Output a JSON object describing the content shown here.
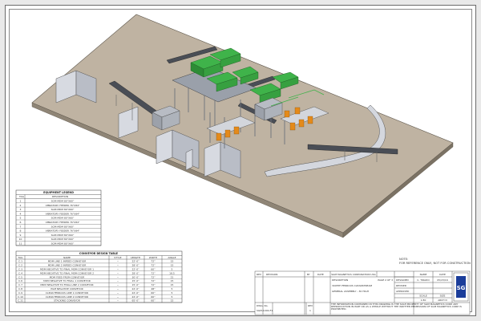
{
  "equipment_legend": {
    "title": "EQUIPMENT LEGEND",
    "headers": [
      "TAG",
      "DESCRIPTION"
    ],
    "rows": [
      [
        "1",
        "SGM MDM 80\"X60\""
      ],
      [
        "2",
        "VIBRATORY FEEDER 76\"X84\""
      ],
      [
        "3",
        "SGM MDM 80\"X60\""
      ],
      [
        "4",
        "VIBRATORY FEEDER 76\"X84\""
      ],
      [
        "5",
        "SGM MDM 80\"X60\""
      ],
      [
        "6",
        "VIBRATORY FEEDER 76\"X84\""
      ],
      [
        "7",
        "SGM MDM 80\"X60\""
      ],
      [
        "8",
        "VIBRATORY FEEDER 76\"X84\""
      ],
      [
        "9",
        "SGM MDM 80\"X60\""
      ],
      [
        "10",
        "SGM MDM 80\"X60\""
      ],
      [
        "11",
        "SGM MDM 80\"X60\""
      ]
    ]
  },
  "conveyor_table": {
    "title": "CONVEYOR DESIGN TABLE",
    "headers": [
      "TAG",
      "NAME",
      "STYLE",
      "LENGTH",
      "WIDTH",
      "ANGLE"
    ],
    "rows": [
      [
        "C.1",
        "MDM LINE 1 INFEED CONVEYOR",
        "--",
        "22'-0\"",
        "72\"",
        "15"
      ],
      [
        "C.2",
        "MDM LINE 2 INFEED CONVEYOR",
        "--",
        "28'-0\"",
        "72\"",
        "15"
      ],
      [
        "C.3",
        "MDM NEGATIVE TO FINAL MDM CONVEYOR 1",
        "--",
        "22'-0\"",
        "60\"",
        "5"
      ],
      [
        "C.4",
        "MDM NEGATIVE TO FINAL MDM CONVEYOR 2",
        "--",
        "28'-0\"",
        "72\"",
        "18.5"
      ],
      [
        "C.5",
        "MDM FEED FROM CONVEYOR",
        "--",
        "30'-0\"",
        "72\"",
        "21"
      ],
      [
        "C.6",
        "MDM NEGATIVE TO FINAL 1 CONVEYOR",
        "--",
        "15'-0\"",
        "72\"",
        "15"
      ],
      [
        "C.7",
        "MDM NEGATIVE TO FINAL LINE 2 CONVEYOR",
        "--",
        "15'-0\"",
        "72\"",
        "15"
      ],
      [
        "C.8",
        "PGM NEGATIVE CONVEYOR",
        "--",
        "22'-0\"",
        "48\"",
        "5"
      ],
      [
        "C.9",
        "CLEAN FERROUS LINE 1 CONVEYOR",
        "--",
        "22'-0\"",
        "60\"",
        "5"
      ],
      [
        "C.10",
        "CLEAN FERROUS LINE 2 CONVEYOR",
        "--",
        "22'-0\"",
        "60\"",
        "5"
      ],
      [
        "C.11",
        "STACKING CONVEYOR",
        "--",
        "65'-0\"",
        "60\"",
        "15"
      ]
    ]
  },
  "note": {
    "line1": "NOTE:",
    "line2": "FOR REFERENCE ONLY, NOT FOR CONSTRUCTION"
  },
  "title_block": {
    "revision_headers": [
      "REV",
      "REVISION",
      "BY",
      "DATE"
    ],
    "company": "SGM MAGNETICS CORPORATION USA",
    "description_label": "DESCRIPTION",
    "page": "PAGE 2 OF 3",
    "line1": "300TPH FERROUS CLEANSTREAM",
    "line2": "GENERAL ASSEMBLY - 30 HIGH",
    "designed_label": "DESIGNED",
    "designed_by": "C. TIRADO",
    "designed_date": "05/23/16",
    "name_label": "NAME",
    "date_label": "DATE",
    "revised_label": "REVISED",
    "approved_label": "APPROVED",
    "scale_label": "SCALE",
    "scale_value": "1:80",
    "size_label": "SIZE",
    "size_value": "ARCH D",
    "dwg_label": "DWG. No.",
    "dwg_value": "SGM-1000-F1",
    "rev_label": "REV",
    "rev_value": "1",
    "disclaimer": "THE INFORMATION CONTAINED IN THIS DRAWING IS THE SOLE PROPERTY OF SGM MAGNETICS CORP. ANY REPRODUCTION IN PART OR AS A WHOLE WITHOUT THE WRITTEN PERMISSION OF SGM MAGNETICS CORP IS PROHIBITED."
  },
  "logo": {
    "text": "SG"
  },
  "colors": {
    "floor": "#bfb3a2",
    "wall": "#cfd3dc",
    "steel": "#8a8f99",
    "machine_green": "#3fb34a",
    "chute_orange": "#e48a1a",
    "belt": "#4a4e56",
    "logo_blue": "#1b3d9a"
  }
}
